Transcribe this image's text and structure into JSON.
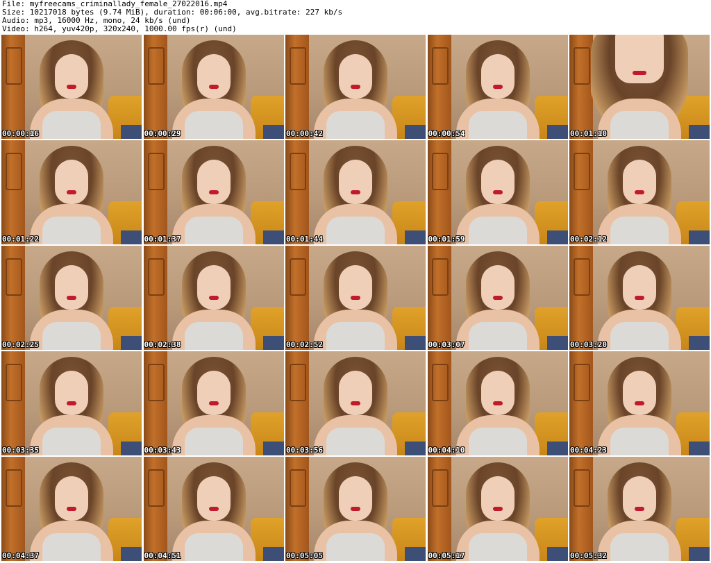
{
  "info": {
    "file": "File: myfreecams_criminallady_female_27022016.mp4",
    "size": "Size: 10217018 bytes (9.74 MiB), duration: 00:06:00, avg.bitrate: 227 kb/s",
    "audio": "Audio: mp3, 16000 Hz, mono, 24 kb/s (und)",
    "video": "Video: h264, yuv420p, 320x240, 1000.00 fps(r) (und)"
  },
  "thumbs": [
    {
      "t": "00:00:16"
    },
    {
      "t": "00:00:29"
    },
    {
      "t": "00:00:42"
    },
    {
      "t": "00:00:54"
    },
    {
      "t": "00:01:10"
    },
    {
      "t": "00:01:22"
    },
    {
      "t": "00:01:37"
    },
    {
      "t": "00:01:44"
    },
    {
      "t": "00:01:59"
    },
    {
      "t": "00:02:12"
    },
    {
      "t": "00:02:25"
    },
    {
      "t": "00:02:38"
    },
    {
      "t": "00:02:52"
    },
    {
      "t": "00:03:07"
    },
    {
      "t": "00:03:20"
    },
    {
      "t": "00:03:35"
    },
    {
      "t": "00:03:43"
    },
    {
      "t": "00:03:56"
    },
    {
      "t": "00:04:10"
    },
    {
      "t": "00:04:23"
    },
    {
      "t": "00:04:37"
    },
    {
      "t": "00:04:51"
    },
    {
      "t": "00:05:05"
    },
    {
      "t": "00:05:17"
    },
    {
      "t": "00:05:32"
    }
  ]
}
